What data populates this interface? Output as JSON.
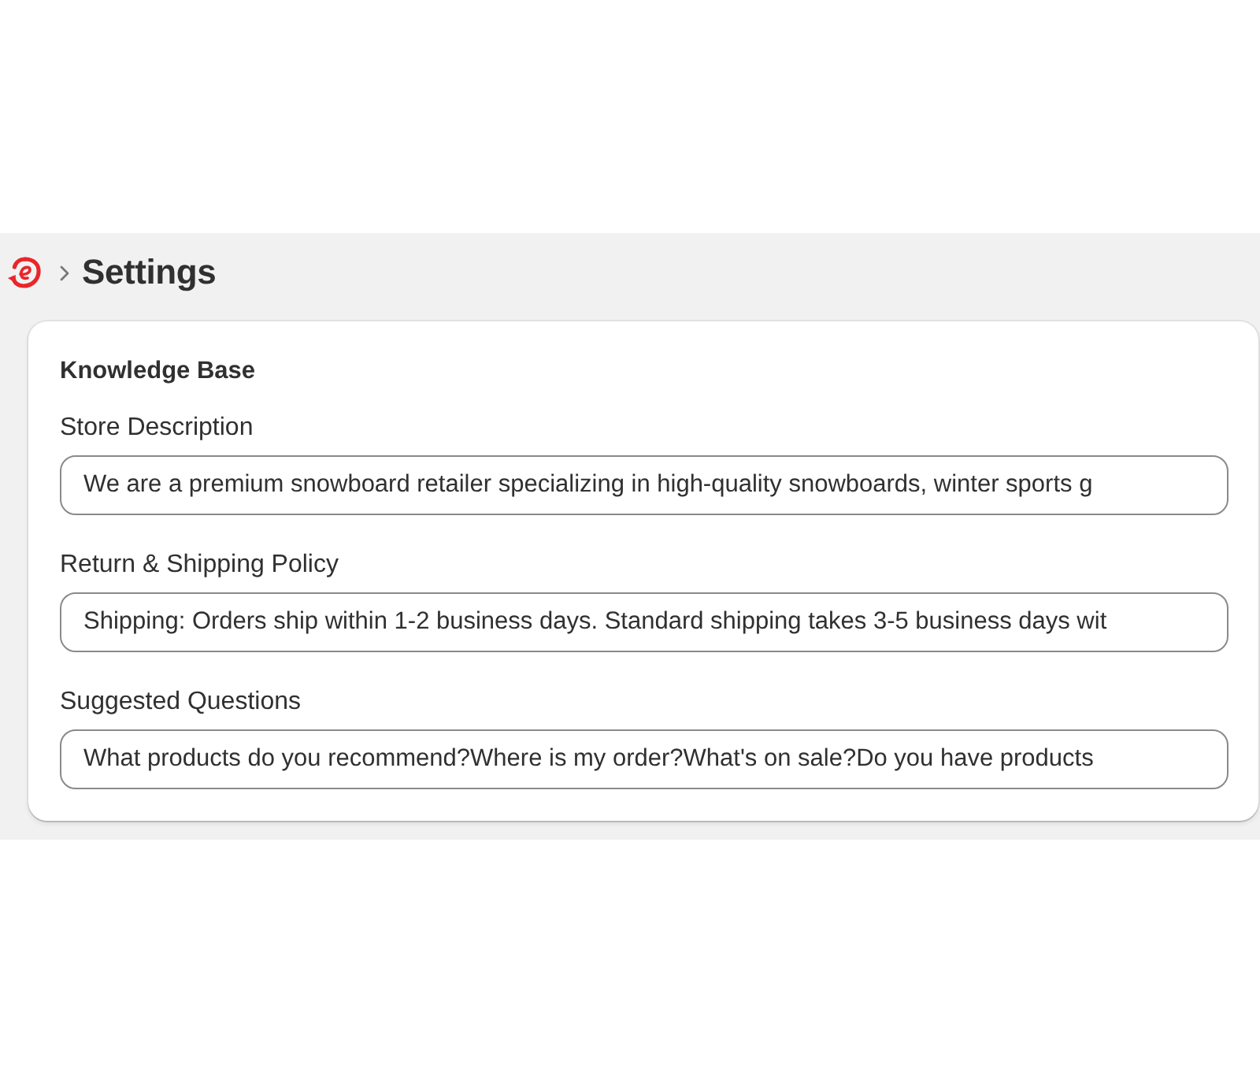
{
  "header": {
    "title": "Settings"
  },
  "card": {
    "title": "Knowledge Base",
    "fields": [
      {
        "label": "Store Description",
        "value": "We are a premium snowboard retailer specializing in high-quality snowboards, winter sports g"
      },
      {
        "label": "Return & Shipping Policy",
        "value": "Shipping: Orders ship within 1-2 business days. Standard shipping takes 3-5 business days wit"
      },
      {
        "label": "Suggested Questions",
        "value": "What products do you recommend?Where is my order?What's on sale?Do you have products"
      }
    ]
  }
}
